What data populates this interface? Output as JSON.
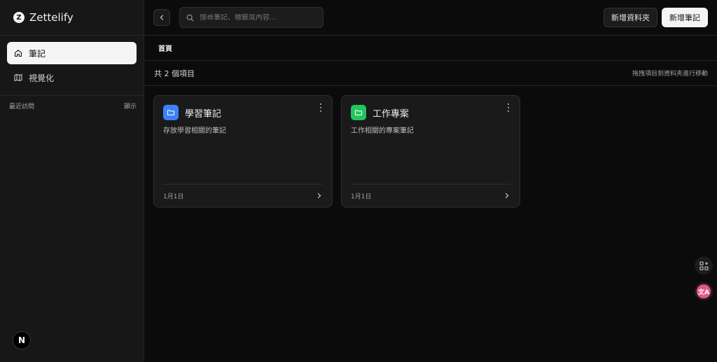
{
  "brand": {
    "logo_letter": "Z",
    "name": "Zettelify"
  },
  "sidebar": {
    "items": [
      {
        "label": "筆記",
        "icon": "home-icon",
        "active": true
      },
      {
        "label": "視覺化",
        "icon": "map-icon",
        "active": false
      }
    ],
    "recent_label": "最近訪問",
    "recent_toggle": "顯示",
    "avatar_letter": "N"
  },
  "topbar": {
    "search_placeholder": "搜尋筆記、標籤或內容...",
    "new_folder_label": "新增資料夾",
    "new_note_label": "新增筆記"
  },
  "breadcrumb": {
    "home": "首頁"
  },
  "list": {
    "count_text": "共 2 個項目",
    "drag_hint": "拖拽項目到資料夾進行移動"
  },
  "folders": [
    {
      "title": "學習筆記",
      "description": "存放學習相關的筆記",
      "date": "1月1日",
      "color": "#3b82f6"
    },
    {
      "title": "工作專案",
      "description": "工作相關的專案筆記",
      "date": "1月1日",
      "color": "#22c55e"
    }
  ],
  "floating": {
    "translate_label": "文A"
  }
}
